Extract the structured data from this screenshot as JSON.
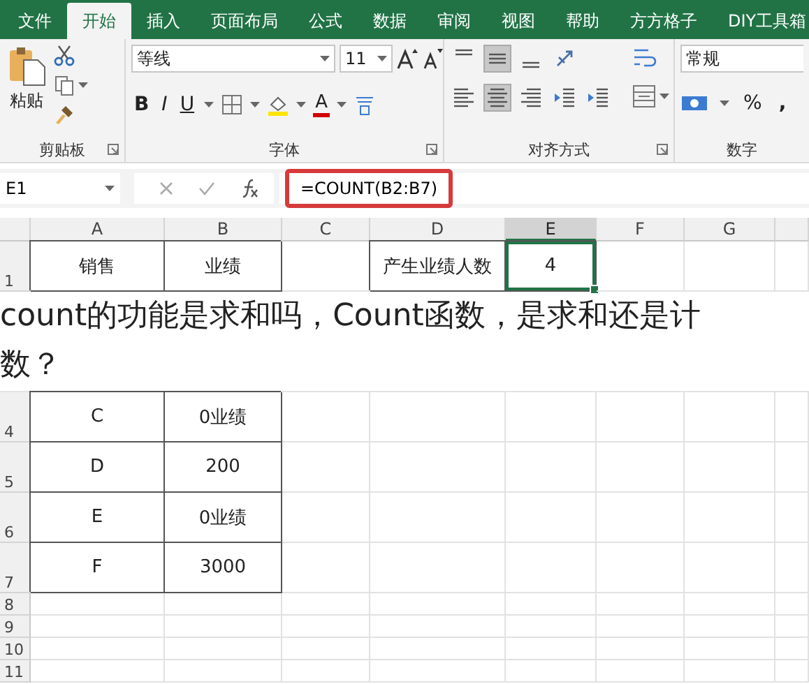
{
  "menu_tabs": [
    {
      "label": "文件",
      "selected": false
    },
    {
      "label": "开始",
      "selected": true
    },
    {
      "label": "插入",
      "selected": false
    },
    {
      "label": "页面布局",
      "selected": false
    },
    {
      "label": "公式",
      "selected": false
    },
    {
      "label": "数据",
      "selected": false
    },
    {
      "label": "审阅",
      "selected": false
    },
    {
      "label": "视图",
      "selected": false
    },
    {
      "label": "帮助",
      "selected": false
    },
    {
      "label": "方方格子",
      "selected": false
    },
    {
      "label": "DIY工具箱",
      "selected": false
    }
  ],
  "ribbon": {
    "groups": [
      {
        "kind": "clipboard",
        "label": "剪贴板",
        "launcher": true,
        "paste_label": "粘贴"
      },
      {
        "kind": "font",
        "label": "字体",
        "launcher": true,
        "font": "等线",
        "size": "11",
        "bold": "B",
        "italic": "I",
        "underline": "U",
        "color_letter": "A"
      },
      {
        "kind": "alignment",
        "label": "对齐方式",
        "launcher": true,
        "buttons": [
          {
            "kind": "top",
            "on": false
          },
          {
            "kind": "middle",
            "on": true
          },
          {
            "kind": "bottom",
            "on": false
          },
          {
            "kind": "orient",
            "on": false
          },
          {
            "kind": "left",
            "on": false
          },
          {
            "kind": "center",
            "on": true
          },
          {
            "kind": "right",
            "on": false
          },
          {
            "kind": "outdent",
            "on": false
          },
          {
            "kind": "indent",
            "on": false
          }
        ]
      },
      {
        "kind": "number",
        "label": "数字",
        "launcher": false,
        "format": "常规",
        "percent": "%",
        "comma": ","
      }
    ]
  },
  "formula_bar": {
    "name_box": "E1",
    "formula": "=COUNT(B2:B7)"
  },
  "sheet": {
    "columns": [
      {
        "label": "A",
        "selected": false
      },
      {
        "label": "B",
        "selected": false
      },
      {
        "label": "C",
        "selected": false
      },
      {
        "label": "D",
        "selected": false
      },
      {
        "label": "E",
        "selected": true
      },
      {
        "label": "F",
        "selected": false
      },
      {
        "label": "G",
        "selected": false
      }
    ],
    "rows": [
      {
        "header": "1",
        "cells": [
          {
            "text": "销售",
            "boxed": true,
            "selected": false
          },
          {
            "text": "业绩",
            "boxed": true,
            "selected": false
          },
          null,
          {
            "text": "产生业绩人数",
            "boxed": true,
            "selected": false
          },
          {
            "text": "4",
            "boxed": true,
            "selected": true
          },
          null,
          null
        ]
      },
      {
        "header": "4",
        "cells": [
          {
            "text": "C",
            "boxed": true,
            "selected": false
          },
          {
            "text": "0业绩",
            "boxed": true,
            "selected": false
          },
          null,
          null,
          null,
          null,
          null
        ]
      },
      {
        "header": "5",
        "cells": [
          {
            "text": "D",
            "boxed": true,
            "selected": false
          },
          {
            "text": "200",
            "boxed": true,
            "selected": false
          },
          null,
          null,
          null,
          null,
          null
        ]
      },
      {
        "header": "6",
        "cells": [
          {
            "text": "E",
            "boxed": true,
            "selected": false
          },
          {
            "text": "0业绩",
            "boxed": true,
            "selected": false
          },
          null,
          null,
          null,
          null,
          null
        ]
      },
      {
        "header": "7",
        "cells": [
          {
            "text": "F",
            "boxed": true,
            "selected": false
          },
          {
            "text": "3000",
            "boxed": true,
            "selected": false
          },
          null,
          null,
          null,
          null,
          null
        ]
      },
      {
        "header": "8"
      },
      {
        "header": "9"
      },
      {
        "header": "10"
      },
      {
        "header": "11"
      }
    ]
  },
  "caption": {
    "lines": [
      "count的功能是求和吗，Count函数，是求和还是计",
      "数？"
    ]
  }
}
